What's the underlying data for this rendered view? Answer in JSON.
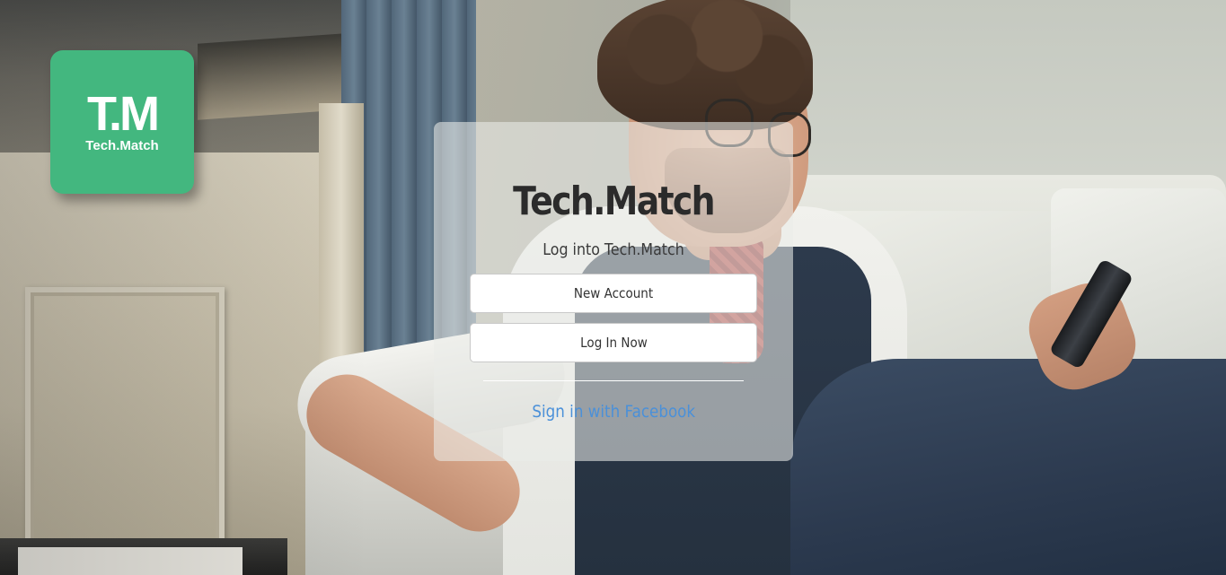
{
  "logo": {
    "mark": "T.M",
    "text": "Tech.Match",
    "color": "#43b77f"
  },
  "login": {
    "title": "Tech.Match",
    "subtitle": "Log into Tech.Match",
    "new_account_label": "New Account",
    "log_in_label": "Log In Now",
    "facebook_label": "Sign in with Facebook",
    "link_color": "#4a90d9"
  }
}
